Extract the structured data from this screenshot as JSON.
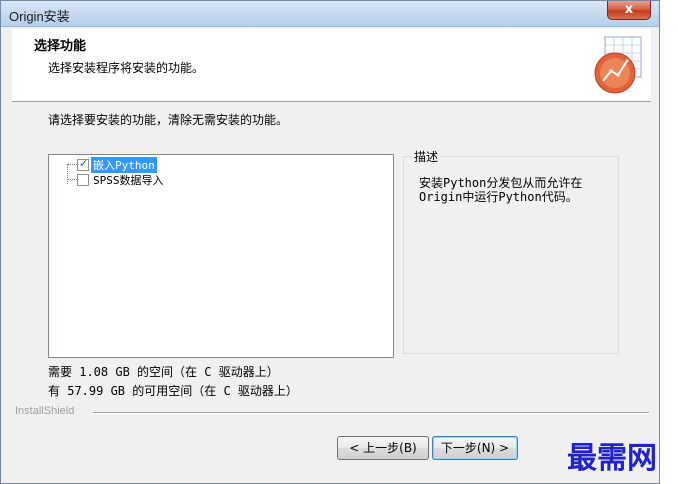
{
  "window": {
    "title": "Origin安装",
    "close_label": "x"
  },
  "header": {
    "title": "选择功能",
    "subtitle": "选择安装程序将安装的功能。",
    "logo_icon": "origin-logo-icon"
  },
  "instructions": "请选择要安装的功能，清除无需安装的功能。",
  "features": [
    {
      "label": "嵌入Python",
      "checked": true,
      "selected": true
    },
    {
      "label": "SPSS数据导入",
      "checked": false,
      "selected": false
    }
  ],
  "description": {
    "legend": "描述",
    "text": "安装Python分发包从而允许在Origin中运行Python代码。"
  },
  "disk": {
    "required": "需要 1.08 GB 的空间（在 C 驱动器上）",
    "available": "有 57.99 GB 的可用空间（在 C 驱动器上）"
  },
  "footer": {
    "brand": "InstallShield"
  },
  "buttons": {
    "back": "< 上一步(B)",
    "next": "下一步(N) >"
  },
  "watermark": "最需网",
  "colors": {
    "selection": "#3399ff",
    "watermark": "#2222cc",
    "accent": "#d9573a"
  }
}
